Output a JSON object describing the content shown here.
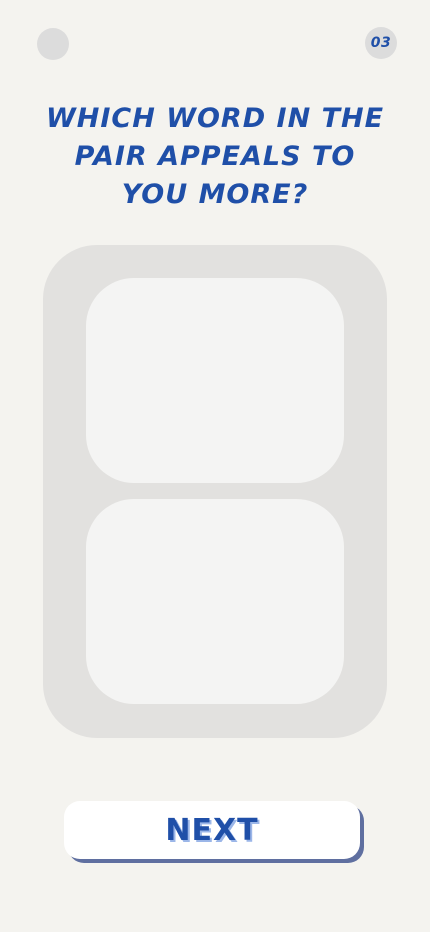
{
  "header": {
    "page_number": "03"
  },
  "question": {
    "text": "WHICH WORD IN THE PAIR APPEALS TO YOU MORE?"
  },
  "choices": [
    {
      "label": ""
    },
    {
      "label": ""
    }
  ],
  "footer": {
    "next_label": "NEXT"
  },
  "colors": {
    "background": "#f4f3ef",
    "accent": "#1f4fa8",
    "panel": "#e2e1df",
    "card": "#f4f4f3",
    "badge": "#dcdcdc"
  }
}
